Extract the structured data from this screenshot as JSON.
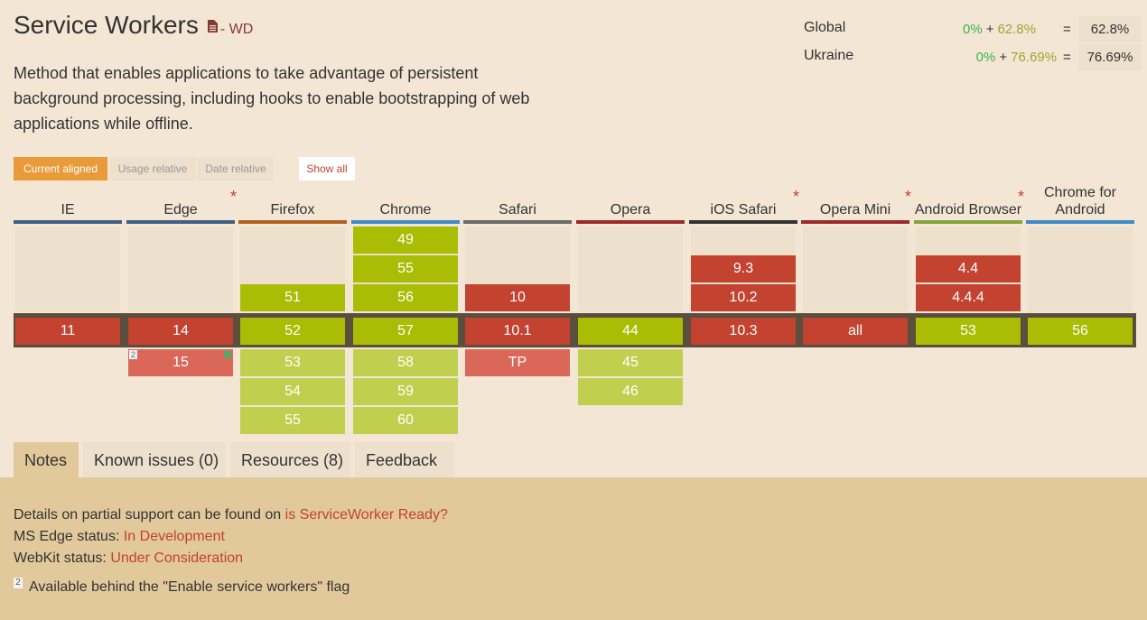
{
  "header": {
    "title": "Service Workers",
    "status": "- WD",
    "description": "Method that enables applications to take advantage of persistent background processing, including hooks to enable bootstrapping of web applications while offline."
  },
  "usage": {
    "rows": [
      {
        "label": "Global",
        "full": "0%",
        "partial": "62.8%",
        "total": "62.8%"
      },
      {
        "label": "Ukraine",
        "full": "0%",
        "partial": "76.69%",
        "total": "76.69%"
      }
    ],
    "plus": "+",
    "equals": "="
  },
  "modes": {
    "current": "Current aligned",
    "usage_relative": "Usage relative",
    "date_relative": "Date relative",
    "show_all": "Show all"
  },
  "browsers": [
    {
      "name": "IE",
      "bar_color": "#3f5f86",
      "asterisk": false,
      "past": [],
      "current": {
        "v": "11",
        "s": "n"
      },
      "future": []
    },
    {
      "name": "Edge",
      "bar_color": "#3f5f86",
      "asterisk": true,
      "past": [],
      "current": {
        "v": "14",
        "s": "n"
      },
      "future": [
        {
          "v": "15",
          "s": "nl",
          "note": "2",
          "flag": true
        }
      ]
    },
    {
      "name": "Firefox",
      "bar_color": "#b1611f",
      "asterisk": false,
      "past": [
        {
          "v": "51",
          "s": "y"
        }
      ],
      "current": {
        "v": "52",
        "s": "y"
      },
      "future": [
        {
          "v": "53",
          "s": "yl"
        },
        {
          "v": "54",
          "s": "yl"
        },
        {
          "v": "55",
          "s": "yl"
        }
      ]
    },
    {
      "name": "Chrome",
      "bar_color": "#3f8ac7",
      "asterisk": false,
      "past": [
        {
          "v": "49",
          "s": "y"
        },
        {
          "v": "55",
          "s": "y"
        },
        {
          "v": "56",
          "s": "y"
        }
      ],
      "current": {
        "v": "57",
        "s": "y"
      },
      "future": [
        {
          "v": "58",
          "s": "yl"
        },
        {
          "v": "59",
          "s": "yl"
        },
        {
          "v": "60",
          "s": "yl"
        }
      ]
    },
    {
      "name": "Safari",
      "bar_color": "#6b6b6b",
      "asterisk": false,
      "past": [
        {
          "v": "10",
          "s": "n"
        }
      ],
      "current": {
        "v": "10.1",
        "s": "n"
      },
      "future": [
        {
          "v": "TP",
          "s": "nl"
        }
      ]
    },
    {
      "name": "Opera",
      "bar_color": "#9c2a2a",
      "asterisk": false,
      "past": [],
      "current": {
        "v": "44",
        "s": "y"
      },
      "future": [
        {
          "v": "45",
          "s": "yl"
        },
        {
          "v": "46",
          "s": "yl"
        }
      ]
    },
    {
      "name": "iOS Safari",
      "bar_color": "#333333",
      "asterisk": true,
      "past": [
        {
          "v": "9.3",
          "s": "n"
        },
        {
          "v": "10.2",
          "s": "n"
        }
      ],
      "current": {
        "v": "10.3",
        "s": "n"
      },
      "future": []
    },
    {
      "name": "Opera Mini",
      "bar_color": "#9c2a2a",
      "asterisk": true,
      "past": [],
      "current": {
        "v": "all",
        "s": "n"
      },
      "future": []
    },
    {
      "name": "Android Browser",
      "bar_color": "#85a63a",
      "asterisk": true,
      "past": [
        {
          "v": "4.4",
          "s": "n"
        },
        {
          "v": "4.4.4",
          "s": "n"
        }
      ],
      "current": {
        "v": "53",
        "s": "y"
      },
      "future": []
    },
    {
      "name": "Chrome for Android",
      "bar_color": "#3f8ac7",
      "asterisk": false,
      "past": [],
      "current": {
        "v": "56",
        "s": "y"
      },
      "future": []
    }
  ],
  "tabs": {
    "notes": "Notes",
    "known_issues": "Known issues (0)",
    "resources": "Resources (8)",
    "feedback": "Feedback"
  },
  "notes": {
    "line1_text": "Details on partial support can be found on ",
    "line1_link": "is ServiceWorker Ready?",
    "line2_text": "MS Edge status: ",
    "line2_link": "In Development",
    "line3_text": "WebKit status: ",
    "line3_link": "Under Consideration",
    "footnote_num": "2",
    "footnote_text": "Available behind the \"Enable service workers\" flag"
  },
  "colors": {
    "supported": "#a8bd04",
    "not_supported": "#c34230",
    "accent": "#e99b3a",
    "background": "#f3e6d4"
  }
}
